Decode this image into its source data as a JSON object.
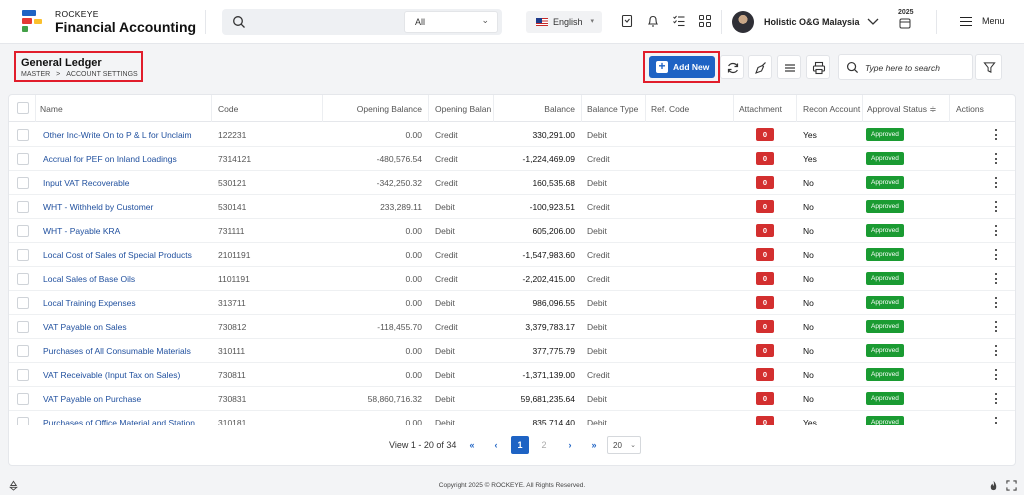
{
  "brand": {
    "small": "ROCKEYE",
    "name": "Financial Accounting"
  },
  "search": {
    "scope": "All"
  },
  "language": "English",
  "user": {
    "name": "Holistic O&G Malaysia"
  },
  "fiscal_year": "2025",
  "menu_label": "Menu",
  "page": {
    "title": "General Ledger",
    "breadcrumb": [
      "MASTER",
      ">",
      "ACCOUNT SETTINGS"
    ]
  },
  "toolbar": {
    "add_label": "Add New",
    "search_placeholder": "Type here to search"
  },
  "table": {
    "headers": {
      "name": "Name",
      "code": "Code",
      "opening_balance": "Opening Balance",
      "opening_balance_type": "Opening Balan",
      "balance": "Balance",
      "balance_type": "Balance Type",
      "ref_code": "Ref. Code",
      "attachment": "Attachment",
      "recon_account": "Recon Account",
      "approval_status": "Approval Status",
      "approval_sort": "≑",
      "actions": "Actions"
    },
    "rows": [
      {
        "name": "Other Inc-Write On to P & L for Unclaim",
        "code": "122231",
        "opening": "0.00",
        "opening_type": "Credit",
        "balance": "330,291.00",
        "balance_type": "Debit",
        "ref": "",
        "attachment": "0",
        "recon": "Yes",
        "status": "Approved"
      },
      {
        "name": "Accrual for PEF on Inland Loadings",
        "code": "7314121",
        "opening": "-480,576.54",
        "opening_type": "Credit",
        "balance": "-1,224,469.09",
        "balance_type": "Credit",
        "ref": "",
        "attachment": "0",
        "recon": "Yes",
        "status": "Approved"
      },
      {
        "name": "Input VAT Recoverable",
        "code": "530121",
        "opening": "-342,250.32",
        "opening_type": "Credit",
        "balance": "160,535.68",
        "balance_type": "Debit",
        "ref": "",
        "attachment": "0",
        "recon": "No",
        "status": "Approved"
      },
      {
        "name": "WHT - Withheld by Customer",
        "code": "530141",
        "opening": "233,289.11",
        "opening_type": "Debit",
        "balance": "-100,923.51",
        "balance_type": "Credit",
        "ref": "",
        "attachment": "0",
        "recon": "No",
        "status": "Approved"
      },
      {
        "name": "WHT - Payable KRA",
        "code": "731111",
        "opening": "0.00",
        "opening_type": "Debit",
        "balance": "605,206.00",
        "balance_type": "Debit",
        "ref": "",
        "attachment": "0",
        "recon": "No",
        "status": "Approved"
      },
      {
        "name": "Local Cost of Sales of Special Products",
        "code": "2101191",
        "opening": "0.00",
        "opening_type": "Credit",
        "balance": "-1,547,983.60",
        "balance_type": "Credit",
        "ref": "",
        "attachment": "0",
        "recon": "No",
        "status": "Approved"
      },
      {
        "name": "Local Sales of Base Oils",
        "code": "1101191",
        "opening": "0.00",
        "opening_type": "Credit",
        "balance": "-2,202,415.00",
        "balance_type": "Credit",
        "ref": "",
        "attachment": "0",
        "recon": "No",
        "status": "Approved"
      },
      {
        "name": "Local Training Expenses",
        "code": "313711",
        "opening": "0.00",
        "opening_type": "Debit",
        "balance": "986,096.55",
        "balance_type": "Debit",
        "ref": "",
        "attachment": "0",
        "recon": "No",
        "status": "Approved"
      },
      {
        "name": "VAT Payable on Sales",
        "code": "730812",
        "opening": "-118,455.70",
        "opening_type": "Credit",
        "balance": "3,379,783.17",
        "balance_type": "Debit",
        "ref": "",
        "attachment": "0",
        "recon": "No",
        "status": "Approved"
      },
      {
        "name": "Purchases of All Consumable Materials",
        "code": "310111",
        "opening": "0.00",
        "opening_type": "Debit",
        "balance": "377,775.79",
        "balance_type": "Debit",
        "ref": "",
        "attachment": "0",
        "recon": "No",
        "status": "Approved"
      },
      {
        "name": "VAT Receivable (Input Tax on Sales)",
        "code": "730811",
        "opening": "0.00",
        "opening_type": "Debit",
        "balance": "-1,371,139.00",
        "balance_type": "Credit",
        "ref": "",
        "attachment": "0",
        "recon": "No",
        "status": "Approved"
      },
      {
        "name": "VAT Payable on Purchase",
        "code": "730831",
        "opening": "58,860,716.32",
        "opening_type": "Debit",
        "balance": "59,681,235.64",
        "balance_type": "Debit",
        "ref": "",
        "attachment": "0",
        "recon": "No",
        "status": "Approved"
      },
      {
        "name": "Purchases of Office Material and Station",
        "code": "310181",
        "opening": "0.00",
        "opening_type": "Debit",
        "balance": "835,714.40",
        "balance_type": "Debit",
        "ref": "",
        "attachment": "0",
        "recon": "Yes",
        "status": "Approved"
      }
    ]
  },
  "pagination": {
    "info": "View 1 - 20 of 34",
    "first": "«",
    "prev": "‹",
    "pages": [
      "1",
      "2"
    ],
    "next": "›",
    "last": "»",
    "page_size": "20"
  },
  "footer": {
    "copyright": "Copyright 2025 © ROCKEYE. All Rights Reserved."
  },
  "colors": {
    "primary": "#1e63c4",
    "approved": "#1a9b32",
    "attachment": "#d32f2f",
    "highlight_border": "#e11d2b"
  },
  "icons": [
    "search-icon",
    "chevron-down-icon",
    "bookmark-icon",
    "bell-icon",
    "checklist-icon",
    "grid-icon",
    "calendar-icon",
    "hamburger-icon",
    "refresh-icon",
    "broom-icon",
    "list-icon",
    "print-icon",
    "filter-icon",
    "more-vertical-icon",
    "recycle-icon",
    "fire-icon",
    "expand-icon"
  ]
}
